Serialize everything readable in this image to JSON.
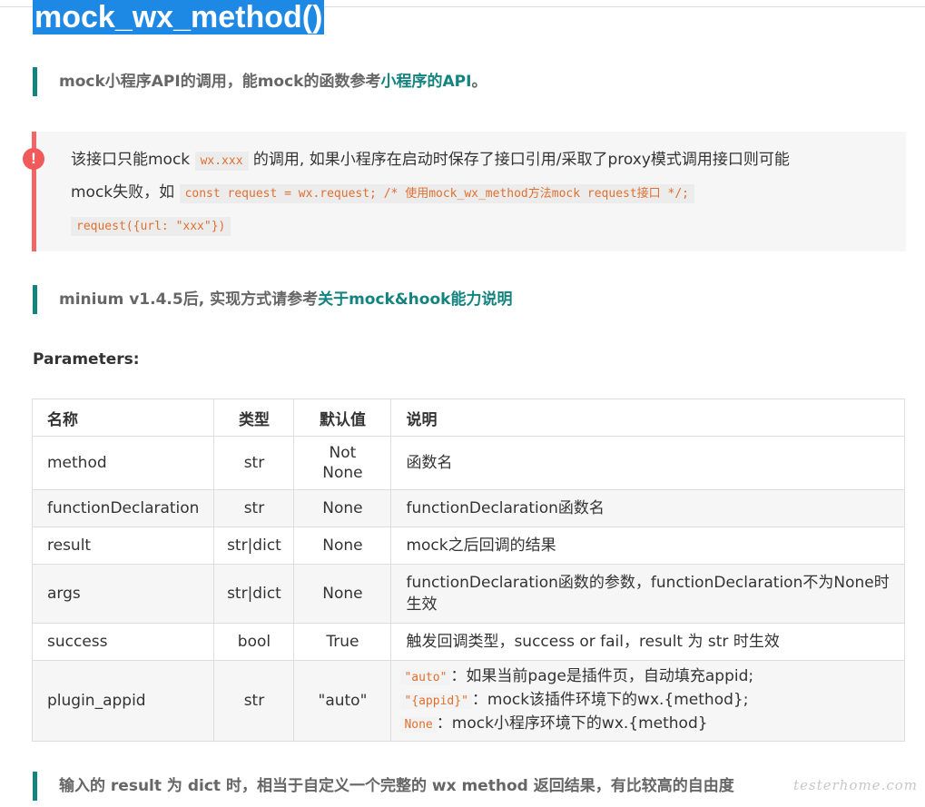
{
  "title": "mock_wx_method()",
  "quote1": {
    "text": "mock小程序API的调用，能mock的函数参考",
    "link": "小程序的API",
    "end": "。"
  },
  "warning": {
    "icon": "exclamation-icon",
    "line1_a": "该接口只能mock ",
    "line1_code": "wx.xxx",
    "line1_b": " 的调用, 如果小程序在启动时保存了接口引用/采取了proxy模式调用接口则可能",
    "line2_a": "mock失败，如 ",
    "line2_code": "const request = wx.request; /* 使用mock_wx_method方法mock request接口 */;",
    "line3_code": "request({url: \"xxx\"})"
  },
  "quote2": {
    "text": "minium v1.4.5后, 实现方式请参考",
    "link": "关于mock&hook能力说明"
  },
  "params_label": "Parameters:",
  "table": {
    "headers": [
      "名称",
      "类型",
      "默认值",
      "说明"
    ],
    "rows": [
      {
        "name": "method",
        "type": "str",
        "default": "Not None",
        "desc": "函数名"
      },
      {
        "name": "functionDeclaration",
        "type": "str",
        "default": "None",
        "desc": "functionDeclaration函数名"
      },
      {
        "name": "result",
        "type": "str|dict",
        "default": "None",
        "desc": "mock之后回调的结果"
      },
      {
        "name": "args",
        "type": "str|dict",
        "default": "None",
        "desc": "functionDeclaration函数的参数，functionDeclaration不为None时生效"
      },
      {
        "name": "success",
        "type": "bool",
        "default": "True",
        "desc": "触发回调类型，success or fail，result 为 str 时生效"
      },
      {
        "name": "plugin_appid",
        "type": "str",
        "default": "\"auto\"",
        "desc_lines": [
          {
            "code": "\"auto\"",
            "text": "：如果当前page是插件页，自动填充appid;"
          },
          {
            "code": "\"{appid}\"",
            "text": "：mock该插件环境下的wx.{method};"
          },
          {
            "code": "None",
            "text": "：mock小程序环境下的wx.{method}"
          }
        ]
      }
    ]
  },
  "quote3": {
    "text": "输入的 result 为 dict 时，相当于自定义一个完整的 wx method 返回结果，有比较高的自由度"
  },
  "watermark": "testerhome.com",
  "colors": {
    "accent": "#138380",
    "warning": "#f06565",
    "highlight": "#1e88e5",
    "code": "#e0702e"
  }
}
